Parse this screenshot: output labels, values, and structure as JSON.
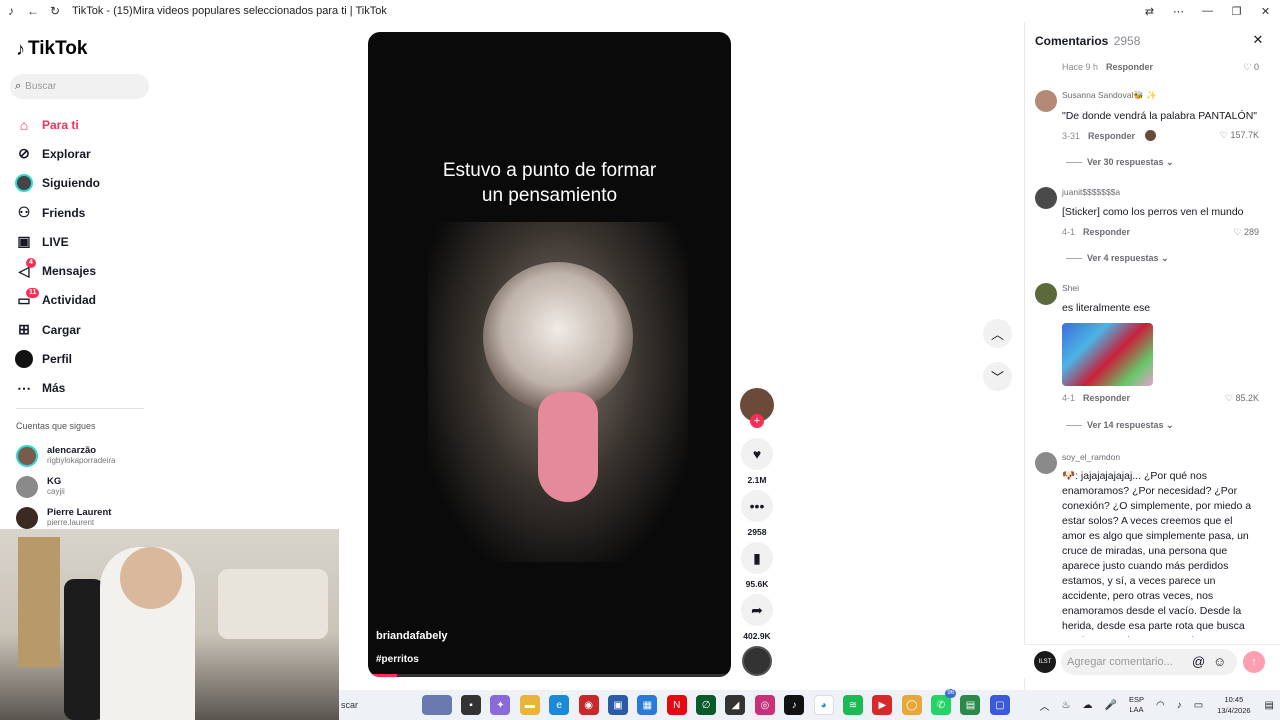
{
  "window": {
    "title": "TikTok - (15)Mira videos populares seleccionados para ti | TikTok"
  },
  "sidebar": {
    "logo": "TikTok",
    "search_placeholder": "Buscar",
    "nav": [
      {
        "label": "Para ti",
        "icon": "home-icon",
        "badge": ""
      },
      {
        "label": "Explorar",
        "icon": "compass-icon",
        "badge": ""
      },
      {
        "label": "Siguiendo",
        "icon": "following-avatar-icon",
        "badge": ""
      },
      {
        "label": "Friends",
        "icon": "friends-icon",
        "badge": ""
      },
      {
        "label": "LIVE",
        "icon": "live-icon",
        "badge": ""
      },
      {
        "label": "Mensajes",
        "icon": "messages-icon",
        "badge": "4"
      },
      {
        "label": "Actividad",
        "icon": "activity-icon",
        "badge": "11"
      },
      {
        "label": "Cargar",
        "icon": "upload-icon",
        "badge": ""
      },
      {
        "label": "Perfil",
        "icon": "profile-icon",
        "badge": ""
      },
      {
        "label": "Más",
        "icon": "more-icon",
        "badge": ""
      }
    ],
    "following_title": "Cuentas que sigues",
    "following": [
      {
        "name": "alencarzão",
        "username": "rigbylokaporradeira"
      },
      {
        "name": "KG",
        "username": "cayjii"
      },
      {
        "name": "Pierre Laurent",
        "username": "pierre.laurent"
      }
    ]
  },
  "video": {
    "caption_line1": "Estuvo a punto de formar",
    "caption_line2": "un pensamiento",
    "author": "briandafabely",
    "hashtag": "#perritos",
    "progress": 0.08
  },
  "actions": {
    "likes": "2.1M",
    "comments": "2958",
    "saves": "95.6K",
    "shares": "402.9K"
  },
  "comments_panel": {
    "title": "Comentarios",
    "count": "2958",
    "top_meta": {
      "time": "Hace 9 h",
      "reply": "Responder",
      "likes": "0"
    },
    "items": [
      {
        "user": "Susanna Sandoval🐝 ✨",
        "text": "\"De donde vendrá la palabra PANTALÓN\"",
        "date": "3-31",
        "reply": "Responder",
        "likes": "157.7K",
        "more": "Ver 30 respuestas"
      },
      {
        "user": "juanit$$$$$$$a",
        "text": "[Sticker] como los perros ven el mundo",
        "date": "4-1",
        "reply": "Responder",
        "likes": "289",
        "more": "Ver 4 respuestas"
      },
      {
        "user": "Shei",
        "text": "es literalmente ese",
        "date": "4-1",
        "reply": "Responder",
        "likes": "85.2K",
        "more": "Ver 14 respuestas"
      },
      {
        "user": "soy_el_ramdon",
        "text": "🐶: jajajajajajaj... ¿Por qué nos enamoramos? ¿Por necesidad? ¿Por conexión? ¿O simplemente, por miedo a estar solos? A veces creemos que el amor es algo que simplemente pasa, un cruce de miradas, una persona que aparece justo cuando más perdidos estamos, y sí, a veces parece un accidente, pero otras veces, nos enamoramos desde el vacío. Desde la herida, desde esa parte rota que busca sentirse completa, porque el amor"
      }
    ],
    "input_placeholder": "Agregar comentario...",
    "input_avatar_text": "ILST"
  },
  "taskbar": {
    "search": "scar",
    "whatsapp_badge": "96",
    "lang_line1": "ESP",
    "lang_line2": "LAA",
    "time": "10:45",
    "date": "13/4/2026"
  }
}
